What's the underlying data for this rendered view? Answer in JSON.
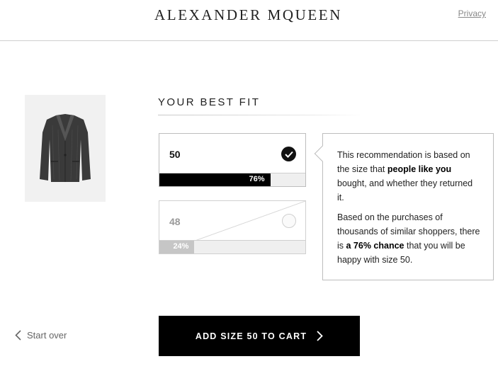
{
  "header": {
    "brand_before_q": "ALEXANDER M",
    "brand_q": "Q",
    "brand_after_q": "UEEN",
    "privacy_label": "Privacy"
  },
  "product": {
    "image_icon": "jacket-icon"
  },
  "fit": {
    "title": "YOUR BEST FIT",
    "sizes": [
      {
        "label": "50",
        "percent": 76,
        "percent_label": "76%",
        "selected": true
      },
      {
        "label": "48",
        "percent": 24,
        "percent_label": "24%",
        "selected": false
      }
    ]
  },
  "info": {
    "p1_pre": "This recommendation is based on the size that ",
    "p1_bold": "people like you",
    "p1_post": " bought, and whether they returned it.",
    "p2_pre": "Based on the purchases of thousands of similar shoppers, there is ",
    "p2_bold": "a 76% chance",
    "p2_post": " that you will be happy with size 50."
  },
  "footer": {
    "start_over_label": "Start over",
    "cart_label": "ADD SIZE 50 TO CART"
  },
  "colors": {
    "primary": "#000000",
    "bar_secondary": "#c6c6c6",
    "muted_text": "#888888"
  }
}
